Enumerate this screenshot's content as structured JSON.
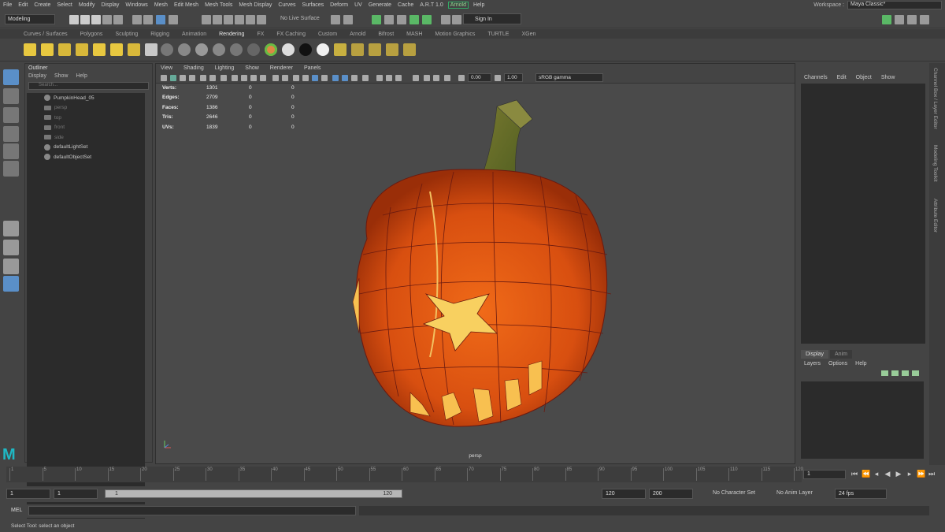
{
  "menubar": {
    "items": [
      "File",
      "Edit",
      "Create",
      "Select",
      "Modify",
      "Display",
      "Windows",
      "Mesh",
      "Edit Mesh",
      "Mesh Tools",
      "Mesh Display",
      "Curves",
      "Surfaces",
      "Deform",
      "UV",
      "Generate",
      "Cache",
      "A.R.T 1.0",
      "Arnold",
      "Help"
    ],
    "workspace_label": "Workspace :",
    "workspace_value": "Maya Classic*"
  },
  "statusline": {
    "mode": "Modeling",
    "live_surface": "No Live Surface",
    "sign_in": "Sign In"
  },
  "shelf": {
    "tabs": [
      "Curves / Surfaces",
      "Polygons",
      "Sculpting",
      "Rigging",
      "Animation",
      "Rendering",
      "FX",
      "FX Caching",
      "Custom",
      "Arnold",
      "Bifrost",
      "MASH",
      "Motion Graphics",
      "TURTLE",
      "XGen"
    ],
    "active_tab": "Rendering"
  },
  "outliner": {
    "title": "Outliner",
    "menu": [
      "Display",
      "Show",
      "Help"
    ],
    "search_placeholder": "Search...",
    "items": [
      {
        "label": "PumpkinHead_05",
        "kind": "mesh"
      },
      {
        "label": "persp",
        "kind": "camera"
      },
      {
        "label": "top",
        "kind": "camera"
      },
      {
        "label": "front",
        "kind": "camera"
      },
      {
        "label": "side",
        "kind": "camera"
      },
      {
        "label": "defaultLightSet",
        "kind": "set"
      },
      {
        "label": "defaultObjectSet",
        "kind": "set"
      }
    ]
  },
  "viewport": {
    "menu": [
      "View",
      "Shading",
      "Lighting",
      "Show",
      "Renderer",
      "Panels"
    ],
    "exposure": "0.00",
    "gamma": "1.00",
    "color_space": "sRGB gamma",
    "camera_label": "persp",
    "hud": [
      {
        "label": "Verts:",
        "v1": "1301",
        "v2": "0",
        "v3": "0"
      },
      {
        "label": "Edges:",
        "v1": "2709",
        "v2": "0",
        "v3": "0"
      },
      {
        "label": "Faces:",
        "v1": "1386",
        "v2": "0",
        "v3": "0"
      },
      {
        "label": "Tris:",
        "v1": "2646",
        "v2": "0",
        "v3": "0"
      },
      {
        "label": "UVs:",
        "v1": "1839",
        "v2": "0",
        "v3": "0"
      }
    ]
  },
  "channelbox": {
    "menu": [
      "Channels",
      "Edit",
      "Object",
      "Show"
    ],
    "layer_tabs": [
      "Display",
      "Anim"
    ],
    "layer_menu": [
      "Layers",
      "Options",
      "Help"
    ]
  },
  "side_tabs": [
    "Channel Box / Layer Editor",
    "Modeling Toolkit",
    "Attribute Editor"
  ],
  "timeline": {
    "ticks": [
      "1",
      "5",
      "10",
      "15",
      "20",
      "25",
      "30",
      "35",
      "40",
      "45",
      "50",
      "55",
      "60",
      "65",
      "70",
      "75",
      "80",
      "85",
      "90",
      "95",
      "100",
      "105",
      "110",
      "115",
      "120"
    ],
    "current_frame": "1"
  },
  "range": {
    "start": "1",
    "playback_start": "1",
    "slider_start": "1",
    "slider_end": "120",
    "playback_end": "120",
    "end": "200",
    "character_set": "No Character Set",
    "anim_layer": "No Anim Layer",
    "fps": "24 fps"
  },
  "command": {
    "mel_label": "MEL"
  },
  "helpline": {
    "text": "Select Tool: select an object"
  },
  "logo": "M"
}
